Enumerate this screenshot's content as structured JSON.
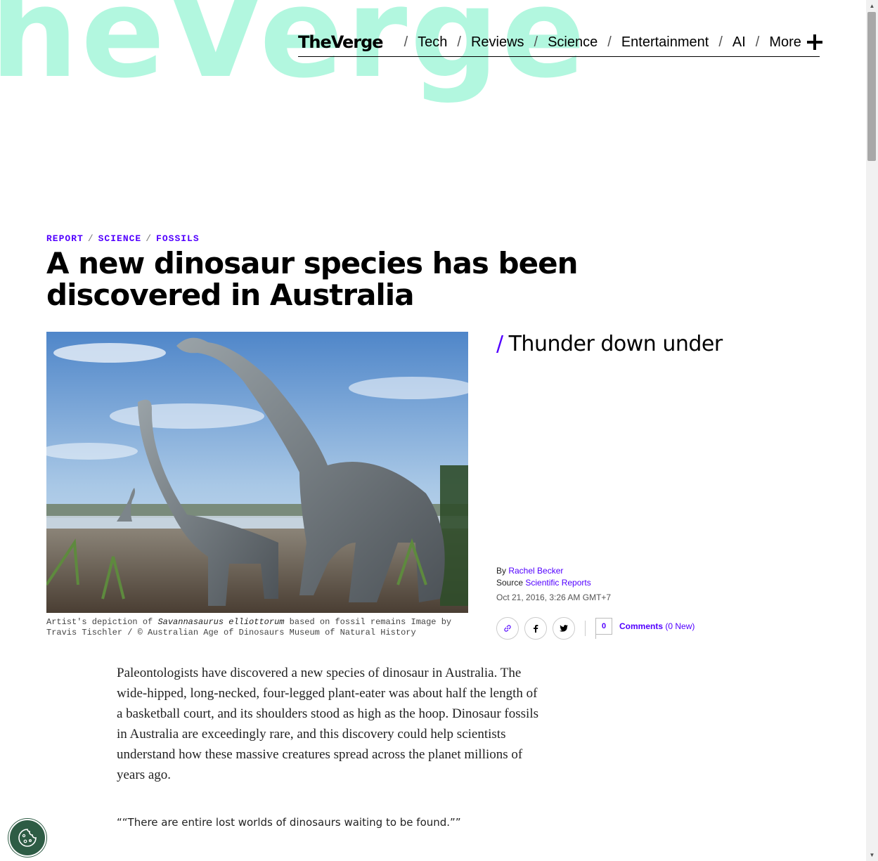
{
  "background_wordmark": "heVerge",
  "nav": {
    "logo": "TheVerge",
    "items": [
      "Tech",
      "Reviews",
      "Science",
      "Entertainment",
      "AI",
      "More"
    ]
  },
  "article": {
    "breadcrumb": [
      "REPORT",
      "SCIENCE",
      "FOSSILS"
    ],
    "headline": "A new dinosaur species has been discovered in Australia",
    "dek": "Thunder down under",
    "caption_prefix": "Artist's depiction of ",
    "caption_species": "Savannasaurus elliottorum",
    "caption_rest": " based on fossil remains Image by Travis Tischler / © Australian Age of Dinosaurs Museum of Natural History",
    "byline_prefix": "By ",
    "author": "Rachel Becker",
    "source_prefix": "Source ",
    "source": "Scientific Reports",
    "date": "Oct 21, 2016, 3:26 AM GMT+7",
    "comment_count": "0",
    "comments_label": "Comments",
    "comments_new": "(0 New)",
    "body": "Paleontologists have discovered a new species of dinosaur in Australia. The wide-hipped, long-necked, four-legged plant-eater was about half the length of a basketball court, and its shoulders stood as high as the hoop. Dinosaur fossils in Australia are exceedingly rare, and this discovery could help scientists understand how these massive creatures spread across the planet millions of years ago.",
    "pullquote": "““There are entire lost worlds of dinosaurs waiting to be found.””"
  },
  "colors": {
    "accent": "#5200ff",
    "wordmark": "#b2f7df",
    "cookie": "#2e5c45"
  }
}
